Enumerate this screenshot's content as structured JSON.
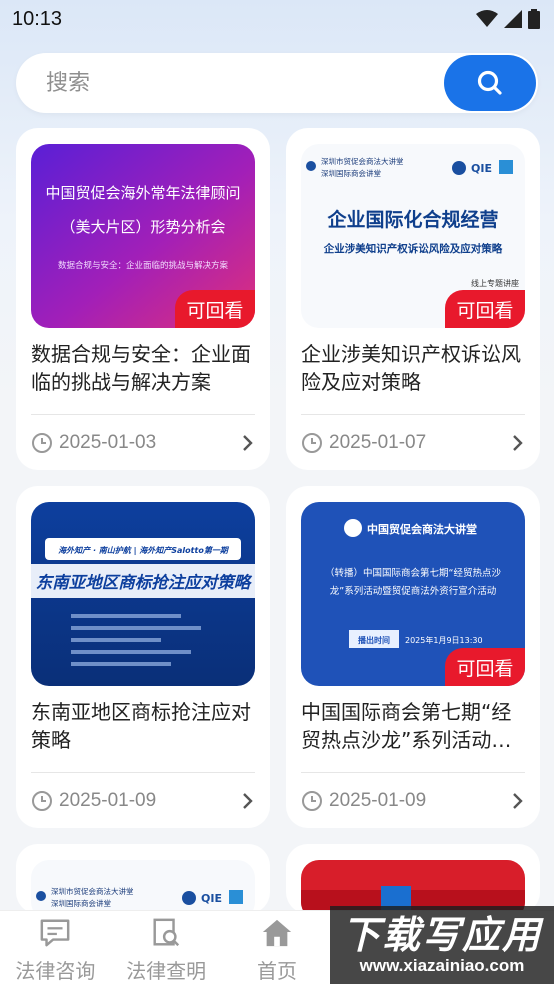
{
  "status_bar": {
    "time": "10:13"
  },
  "search": {
    "placeholder": "搜索",
    "button_icon": "search-icon"
  },
  "cards": [
    {
      "title": "数据合规与安全：企业面临的挑战与解决方案",
      "date": "2025-01-03",
      "badge": "可回看",
      "thumb": {
        "line1": "中国贸促会海外常年法律顾问",
        "line2": "（美大片区）形势分析会",
        "line3": "数据合规与安全：企业面临的挑战与解决方案"
      }
    },
    {
      "title": "企业涉美知识产权诉讼风险及应对策略",
      "date": "2025-01-07",
      "badge": "可回看",
      "thumb": {
        "org1": "深圳市贸促会商法大讲堂",
        "org2": "深圳国际商会讲堂",
        "line1": "企业国际化合规经营",
        "line2": "企业涉美知识产权诉讼风险及应对策略",
        "line3": "线上专题讲座"
      }
    },
    {
      "title": "东南亚地区商标抢注应对策略",
      "date": "2025-01-09",
      "badge": "",
      "thumb": {
        "line1": "海外知产 · 南山护航 | 海外知产Salotto第一期",
        "line2": "东南亚地区商标抢注应对策略"
      }
    },
    {
      "title": "中国国际商会第七期“经贸热点沙龙”系列活动暨贸促商法外资行宣介活动",
      "date": "2025-01-09",
      "badge": "可回看",
      "thumb": {
        "org": "中国贸促会商法大讲堂",
        "line1": "（转播）中国国际商会第七期“经贸热点沙",
        "line2": "龙”系列活动暨贸促商法外资行宣介活动",
        "time_label": "播出时间",
        "time": "2025年1月9日13:30"
      }
    },
    {
      "thumb": {
        "org1": "深圳市贸促会商法大讲堂",
        "org2": "深圳国际商会讲堂"
      }
    },
    {
      "thumb": {}
    }
  ],
  "tabs": [
    {
      "label": "法律咨询",
      "icon": "chat-icon"
    },
    {
      "label": "法律查明",
      "icon": "document-search-icon"
    },
    {
      "label": "首页",
      "icon": "home-icon"
    },
    {
      "label": "",
      "icon": ""
    },
    {
      "label": "",
      "icon": ""
    }
  ],
  "watermark": {
    "main": "下载写应用",
    "sub": "www.xiazainiao.com"
  },
  "colors": {
    "accent": "#1a73e8",
    "badge": "#e8192c"
  }
}
